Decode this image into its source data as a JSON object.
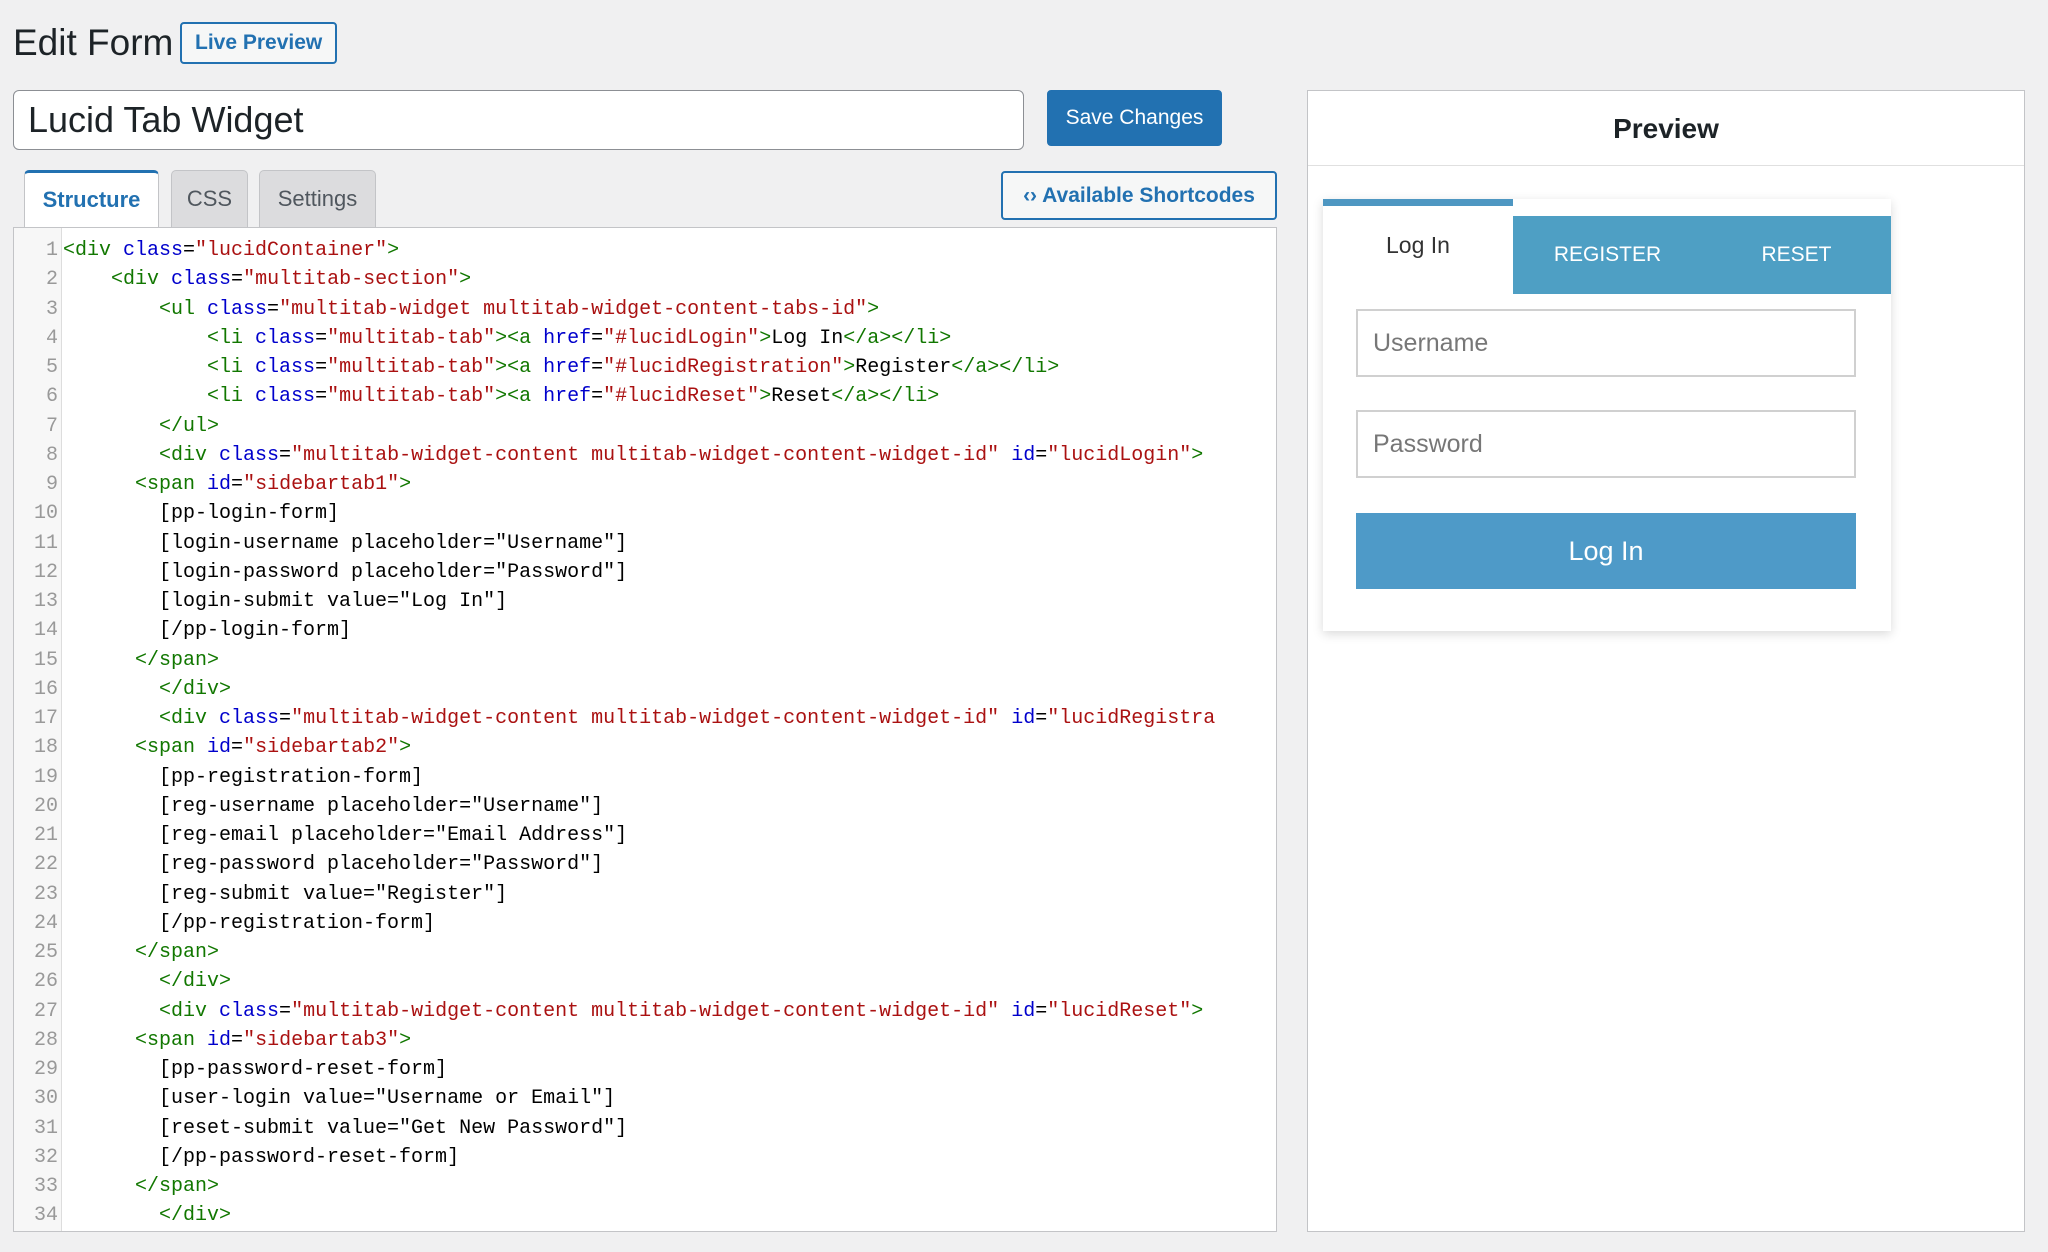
{
  "header": {
    "title": "Edit Form",
    "live_preview_label": "Live Preview"
  },
  "form": {
    "title_value": "Lucid Tab Widget",
    "save_label": "Save Changes"
  },
  "tabs": [
    {
      "label": "Structure",
      "active": true
    },
    {
      "label": "CSS",
      "active": false
    },
    {
      "label": "Settings",
      "active": false
    }
  ],
  "shortcodes_button": {
    "icon": "code-icon",
    "label": "Available Shortcodes"
  },
  "editor": {
    "lines": [
      [
        [
          "t",
          "<div "
        ],
        [
          "a",
          "class"
        ],
        [
          "d",
          "="
        ],
        [
          "s",
          "\"lucidContainer\""
        ],
        [
          "t",
          ">"
        ]
      ],
      [
        [
          "d",
          "    "
        ],
        [
          "t",
          "<div "
        ],
        [
          "a",
          "class"
        ],
        [
          "d",
          "="
        ],
        [
          "s",
          "\"multitab-section\""
        ],
        [
          "t",
          ">"
        ]
      ],
      [
        [
          "d",
          "        "
        ],
        [
          "t",
          "<ul "
        ],
        [
          "a",
          "class"
        ],
        [
          "d",
          "="
        ],
        [
          "s",
          "\"multitab-widget multitab-widget-content-tabs-id\""
        ],
        [
          "t",
          ">"
        ]
      ],
      [
        [
          "d",
          "            "
        ],
        [
          "t",
          "<li "
        ],
        [
          "a",
          "class"
        ],
        [
          "d",
          "="
        ],
        [
          "s",
          "\"multitab-tab\""
        ],
        [
          "t",
          "><a "
        ],
        [
          "a",
          "href"
        ],
        [
          "d",
          "="
        ],
        [
          "s",
          "\"#lucidLogin\""
        ],
        [
          "t",
          ">"
        ],
        [
          "d",
          "Log In"
        ],
        [
          "t",
          "</a></li>"
        ]
      ],
      [
        [
          "d",
          "            "
        ],
        [
          "t",
          "<li "
        ],
        [
          "a",
          "class"
        ],
        [
          "d",
          "="
        ],
        [
          "s",
          "\"multitab-tab\""
        ],
        [
          "t",
          "><a "
        ],
        [
          "a",
          "href"
        ],
        [
          "d",
          "="
        ],
        [
          "s",
          "\"#lucidRegistration\""
        ],
        [
          "t",
          ">"
        ],
        [
          "d",
          "Register"
        ],
        [
          "t",
          "</a></li>"
        ]
      ],
      [
        [
          "d",
          "            "
        ],
        [
          "t",
          "<li "
        ],
        [
          "a",
          "class"
        ],
        [
          "d",
          "="
        ],
        [
          "s",
          "\"multitab-tab\""
        ],
        [
          "t",
          "><a "
        ],
        [
          "a",
          "href"
        ],
        [
          "d",
          "="
        ],
        [
          "s",
          "\"#lucidReset\""
        ],
        [
          "t",
          ">"
        ],
        [
          "d",
          "Reset"
        ],
        [
          "t",
          "</a></li>"
        ]
      ],
      [
        [
          "d",
          "        "
        ],
        [
          "t",
          "</ul>"
        ]
      ],
      [
        [
          "d",
          "        "
        ],
        [
          "t",
          "<div "
        ],
        [
          "a",
          "class"
        ],
        [
          "d",
          "="
        ],
        [
          "s",
          "\"multitab-widget-content multitab-widget-content-widget-id\""
        ],
        [
          "d",
          " "
        ],
        [
          "a",
          "id"
        ],
        [
          "d",
          "="
        ],
        [
          "s",
          "\"lucidLogin\""
        ],
        [
          "t",
          ">"
        ]
      ],
      [
        [
          "d",
          "      "
        ],
        [
          "t",
          "<span "
        ],
        [
          "a",
          "id"
        ],
        [
          "d",
          "="
        ],
        [
          "s",
          "\"sidebartab1\""
        ],
        [
          "t",
          ">"
        ]
      ],
      [
        [
          "d",
          "        [pp-login-form]"
        ]
      ],
      [
        [
          "d",
          "        [login-username placeholder=\"Username\"]"
        ]
      ],
      [
        [
          "d",
          "        [login-password placeholder=\"Password\"]"
        ]
      ],
      [
        [
          "d",
          "        [login-submit value=\"Log In\"]"
        ]
      ],
      [
        [
          "d",
          "        [/pp-login-form]"
        ]
      ],
      [
        [
          "d",
          "      "
        ],
        [
          "t",
          "</span>"
        ]
      ],
      [
        [
          "d",
          "        "
        ],
        [
          "t",
          "</div>"
        ]
      ],
      [
        [
          "d",
          "        "
        ],
        [
          "t",
          "<div "
        ],
        [
          "a",
          "class"
        ],
        [
          "d",
          "="
        ],
        [
          "s",
          "\"multitab-widget-content multitab-widget-content-widget-id\""
        ],
        [
          "d",
          " "
        ],
        [
          "a",
          "id"
        ],
        [
          "d",
          "="
        ],
        [
          "s",
          "\"lucidRegistra"
        ]
      ],
      [
        [
          "d",
          "      "
        ],
        [
          "t",
          "<span "
        ],
        [
          "a",
          "id"
        ],
        [
          "d",
          "="
        ],
        [
          "s",
          "\"sidebartab2\""
        ],
        [
          "t",
          ">"
        ]
      ],
      [
        [
          "d",
          "        [pp-registration-form]"
        ]
      ],
      [
        [
          "d",
          "        [reg-username placeholder=\"Username\"]"
        ]
      ],
      [
        [
          "d",
          "        [reg-email placeholder=\"Email Address\"]"
        ]
      ],
      [
        [
          "d",
          "        [reg-password placeholder=\"Password\"]"
        ]
      ],
      [
        [
          "d",
          "        [reg-submit value=\"Register\"]"
        ]
      ],
      [
        [
          "d",
          "        [/pp-registration-form]"
        ]
      ],
      [
        [
          "d",
          "      "
        ],
        [
          "t",
          "</span>"
        ]
      ],
      [
        [
          "d",
          "        "
        ],
        [
          "t",
          "</div>"
        ]
      ],
      [
        [
          "d",
          "        "
        ],
        [
          "t",
          "<div "
        ],
        [
          "a",
          "class"
        ],
        [
          "d",
          "="
        ],
        [
          "s",
          "\"multitab-widget-content multitab-widget-content-widget-id\""
        ],
        [
          "d",
          " "
        ],
        [
          "a",
          "id"
        ],
        [
          "d",
          "="
        ],
        [
          "s",
          "\"lucidReset\""
        ],
        [
          "t",
          ">"
        ]
      ],
      [
        [
          "d",
          "      "
        ],
        [
          "t",
          "<span "
        ],
        [
          "a",
          "id"
        ],
        [
          "d",
          "="
        ],
        [
          "s",
          "\"sidebartab3\""
        ],
        [
          "t",
          ">"
        ]
      ],
      [
        [
          "d",
          "        [pp-password-reset-form]"
        ]
      ],
      [
        [
          "d",
          "        [user-login value=\"Username or Email\"]"
        ]
      ],
      [
        [
          "d",
          "        [reset-submit value=\"Get New Password\"]"
        ]
      ],
      [
        [
          "d",
          "        [/pp-password-reset-form]"
        ]
      ],
      [
        [
          "d",
          "      "
        ],
        [
          "t",
          "</span>"
        ]
      ],
      [
        [
          "d",
          "        "
        ],
        [
          "t",
          "</div>"
        ]
      ]
    ]
  },
  "preview": {
    "title": "Preview",
    "tabs": [
      "Log In",
      "REGISTER",
      "RESET"
    ],
    "username_placeholder": "Username",
    "password_placeholder": "Password",
    "submit_label": "Log In",
    "accent_color": "#4e9fc4"
  }
}
